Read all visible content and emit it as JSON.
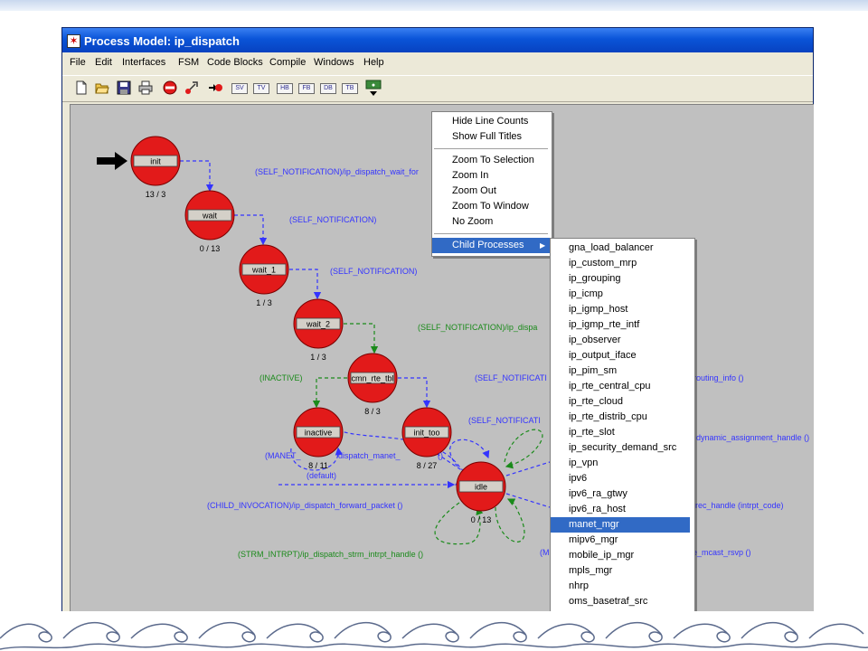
{
  "window": {
    "title": "Process Model: ip_dispatch"
  },
  "menubar": {
    "items": [
      "File",
      "Edit",
      "Interfaces",
      "FSM",
      "Code Blocks",
      "Compile",
      "Windows",
      "Help"
    ]
  },
  "toolbar": {
    "icons": [
      "new-icon",
      "open-icon",
      "save-icon",
      "print-icon",
      "stop-icon",
      "unforced-state-icon",
      "forced-state-icon",
      "transition-icon"
    ],
    "text_buttons": [
      "SV",
      "TV",
      "HB",
      "FB",
      "DB",
      "TB"
    ]
  },
  "states": [
    {
      "name": "init",
      "counts": "13 / 3"
    },
    {
      "name": "wait",
      "counts": "0 / 13"
    },
    {
      "name": "wait_1",
      "counts": "1 / 3"
    },
    {
      "name": "wait_2",
      "counts": "1 / 3"
    },
    {
      "name": "cmn_rte_tbl",
      "counts": "8 / 3"
    },
    {
      "name": "inactive",
      "counts": "8 / 11"
    },
    {
      "name": "init_too",
      "counts": "8 / 27"
    },
    {
      "name": "idle",
      "counts": "0 / 13"
    }
  ],
  "transitions": [
    "(SELF_NOTIFICATION)/ip_dispatch_wait_for",
    "(SELF_NOTIFICATION)",
    "(SELF_NOTIFICATION)",
    "(SELF_NOTIFICATION)/ip_dispa",
    "(INACTIVE)",
    "(SELF_NOTIFICATI",
    "routing_info ()",
    "(SELF_NOTIFICATI",
    "dynamic_assignment_handle ()",
    "(MANET_",
    "dispatch_manet_",
    "()",
    "(default)",
    "(CHILD_INVOCATION)/ip_dispatch_forward_packet ()",
    "rec_handle (intrpt_code)",
    "(STRM_INTRPT)/ip_dispatch_strm_intrpt_handle ()",
    "(M",
    "e_mcast_rsvp ()"
  ],
  "context_menu": {
    "group1": [
      "Hide Line Counts",
      "Show Full Titles"
    ],
    "group2": [
      "Zoom To Selection",
      "Zoom In",
      "Zoom Out",
      "Zoom To Window",
      "No Zoom"
    ],
    "group3": [
      "Child Processes"
    ]
  },
  "submenu": {
    "items": [
      "gna_load_balancer",
      "ip_custom_mrp",
      "ip_grouping",
      "ip_icmp",
      "ip_igmp_host",
      "ip_igmp_rte_intf",
      "ip_observer",
      "ip_output_iface",
      "ip_pim_sm",
      "ip_rte_central_cpu",
      "ip_rte_cloud",
      "ip_rte_distrib_cpu",
      "ip_rte_slot",
      "ip_security_demand_src",
      "ip_vpn",
      "ipv6",
      "ipv6_ra_gtwy",
      "ipv6_ra_host",
      "manet_mgr",
      "mipv6_mgr",
      "mobile_ip_mgr",
      "mpls_mgr",
      "nhrp",
      "oms_basetraf_src"
    ],
    "selected": "manet_mgr"
  },
  "colors": {
    "state_fill": "#e21a1a",
    "blue_trans": "#3333ff",
    "green_trans": "#1a8a1a",
    "highlight": "#316ac5",
    "canvas": "#c0c0c0"
  }
}
